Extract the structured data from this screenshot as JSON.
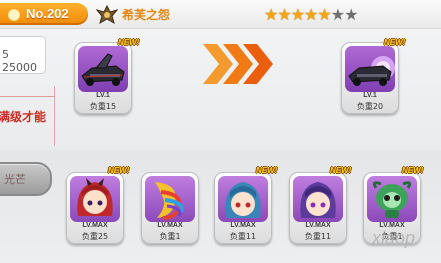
{
  "header": {
    "number": "No.202",
    "title": "希芙之怨",
    "stars_filled": 5,
    "stars_total": 7
  },
  "left_panel": {
    "price": "5 25000",
    "note": "满级才能",
    "gray_button_label": "光芒"
  },
  "new_label": "NEW!",
  "top_items": [
    {
      "level": "LV.1",
      "weight": "负重15",
      "icon": "dark-vehicle-icon"
    },
    {
      "level": "LV.1",
      "weight": "负重20",
      "icon": "dark-vehicle-glow-icon"
    }
  ],
  "bottom_items": [
    {
      "level": "LV.MAX",
      "weight": "负重25",
      "icon": "red-haired-character-icon"
    },
    {
      "level": "LV.MAX",
      "weight": "负重1",
      "icon": "rainbow-wing-icon"
    },
    {
      "level": "LV.MAX",
      "weight": "负重11",
      "icon": "blue-haired-character-icon"
    },
    {
      "level": "LV.MAX",
      "weight": "负重11",
      "icon": "purple-haired-character-icon"
    },
    {
      "level": "LV.MAX",
      "weight": "负重1",
      "icon": "green-creature-icon"
    }
  ],
  "watermark": "xiaop",
  "colors": {
    "badge_orange": "#f39a14",
    "title_orange": "#e7860f",
    "note_red": "#cc2c1f",
    "arrow_orange": "#f07a14",
    "new_yellow": "#ffcf1f"
  }
}
